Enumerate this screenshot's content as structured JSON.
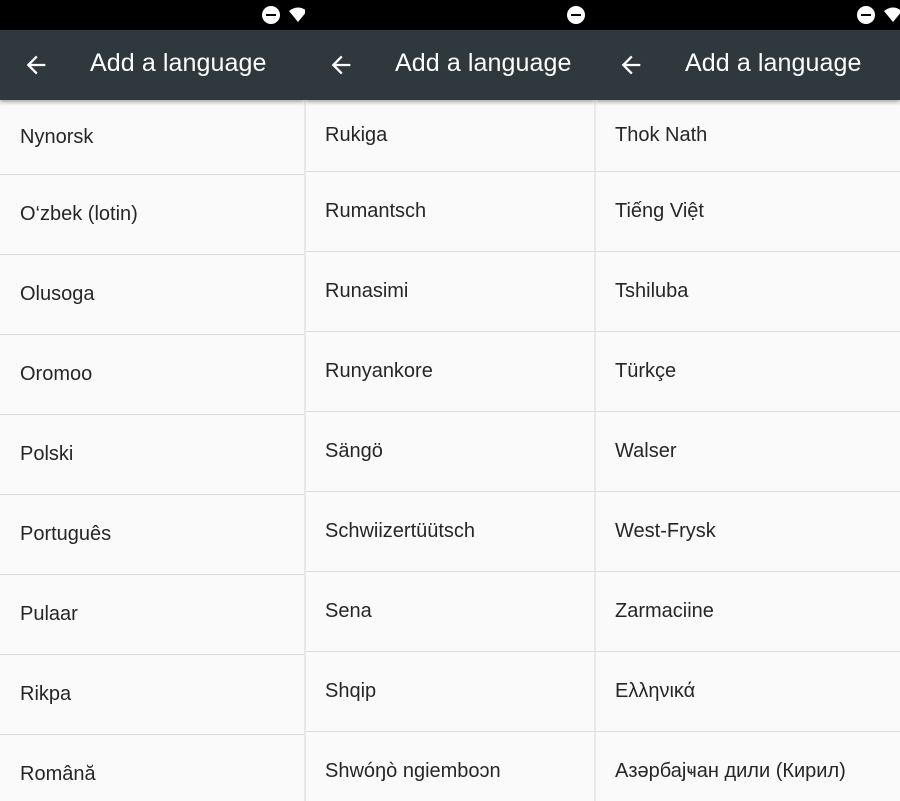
{
  "screen_title": "Add a language",
  "panels": [
    {
      "title": "Add a language",
      "items": [
        "Nynorsk",
        "O‘zbek (lotin)",
        "Olusoga",
        "Oromoo",
        "Polski",
        "Português",
        "Pulaar",
        "Rikpa",
        "Română"
      ]
    },
    {
      "title": "Add a language",
      "items": [
        "Rukiga",
        "Rumantsch",
        "Runasimi",
        "Runyankore",
        "Sängö",
        "Schwiizertüütsch",
        "Sena",
        "Shqip",
        "Shwóŋò ngiemboɔn"
      ]
    },
    {
      "title": "Add a language",
      "items": [
        "Thok Nath",
        "Tiếng Việt",
        "Tshiluba",
        "Türkçe",
        "Walser",
        "West-Frysk",
        "Zarmaciine",
        "Ελληνικά",
        "Азәрбајҹан дили (Кирил)"
      ]
    }
  ],
  "colors": {
    "appbar": "#2f383c",
    "statusbar": "#000000",
    "list_bg": "#fafafa",
    "divider": "#dcdcdc",
    "text": "#262626"
  },
  "icons": [
    "back-arrow-icon",
    "do-not-disturb-icon",
    "wifi-icon"
  ]
}
